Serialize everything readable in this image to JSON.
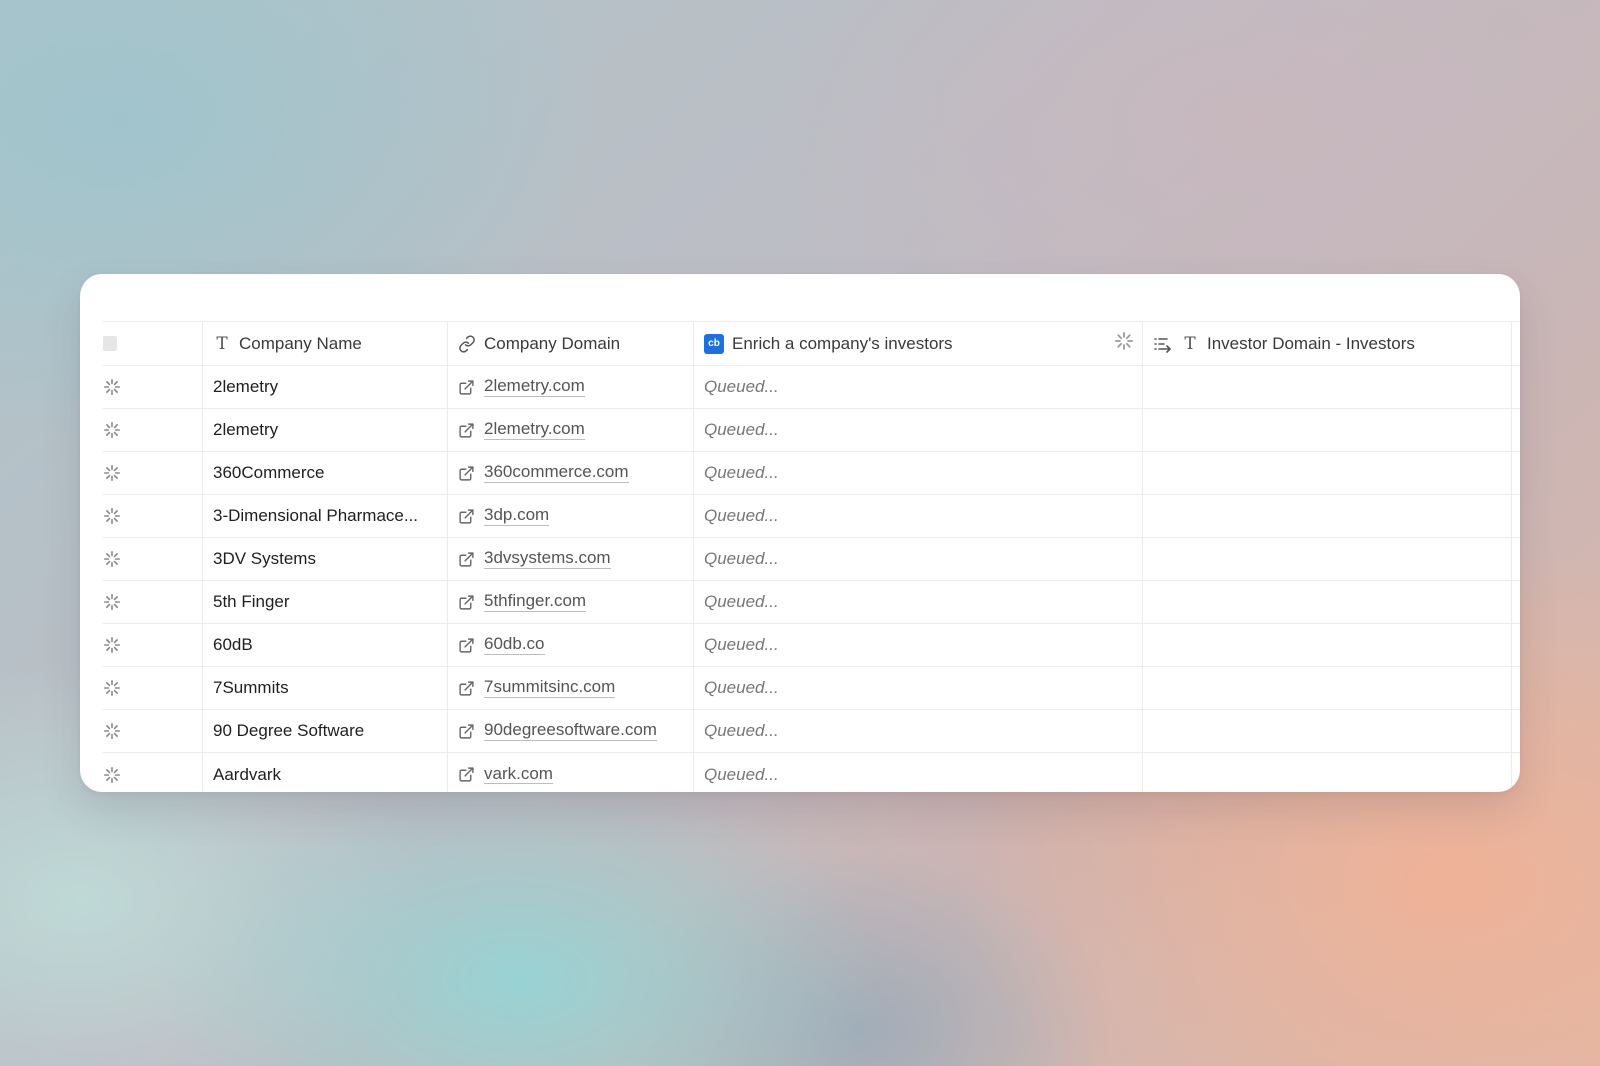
{
  "table": {
    "columns": [
      {
        "label": "Company Name",
        "icon": "text-type-icon"
      },
      {
        "label": "Company Domain",
        "icon": "link-icon"
      },
      {
        "label": "Enrich a company's investors",
        "icon": "crunchbase-icon",
        "badge": "cb",
        "badge_color": "#1f6fe0"
      },
      {
        "label": "Investor Domain - Investors",
        "icon": "text-type-icon"
      }
    ],
    "rows": [
      {
        "name": "2lemetry",
        "domain": "2lemetry.com",
        "status": "Queued...",
        "investor_domain": ""
      },
      {
        "name": "2lemetry",
        "domain": "2lemetry.com",
        "status": "Queued...",
        "investor_domain": ""
      },
      {
        "name": "360Commerce",
        "domain": "360commerce.com",
        "status": "Queued...",
        "investor_domain": ""
      },
      {
        "name": "3-Dimensional Pharmace...",
        "domain": "3dp.com",
        "status": "Queued...",
        "investor_domain": ""
      },
      {
        "name": "3DV Systems",
        "domain": "3dvsystems.com",
        "status": "Queued...",
        "investor_domain": ""
      },
      {
        "name": "5th Finger",
        "domain": "5thfinger.com",
        "status": "Queued...",
        "investor_domain": ""
      },
      {
        "name": "60dB",
        "domain": "60db.co",
        "status": "Queued...",
        "investor_domain": ""
      },
      {
        "name": "7Summits",
        "domain": "7summitsinc.com",
        "status": "Queued...",
        "investor_domain": ""
      },
      {
        "name": "90 Degree Software",
        "domain": "90degreesoftware.com",
        "status": "Queued...",
        "investor_domain": ""
      },
      {
        "name": "Aardvark",
        "domain": "vark.com",
        "status": "Queued...",
        "investor_domain": ""
      }
    ]
  },
  "colors": {
    "accent_badge": "#1f6fe0",
    "grid_line": "#ececec",
    "queued_text": "#777777"
  }
}
